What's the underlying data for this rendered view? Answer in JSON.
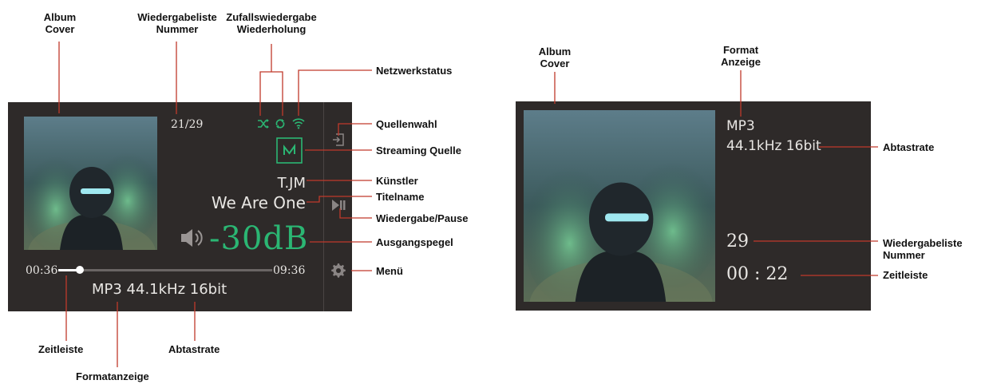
{
  "colors": {
    "screen": "#2e2a29",
    "accent": "#2bb673",
    "callout_line": "#c0392b",
    "text": "#e8e6e3"
  },
  "left_screen": {
    "playlist_number": "21/29",
    "artist": "T.JM",
    "title": "We Are One",
    "volume": "-30dB",
    "time_elapsed": "00:36",
    "time_total": "09:36",
    "progress_fraction": 0.1,
    "format_info": "MP3 44.1kHz 16bit",
    "icons": [
      "shuffle-icon",
      "repeat-icon",
      "wifi-icon",
      "input-source-icon",
      "streaming-source-icon",
      "play-pause-icon",
      "speaker-icon",
      "gear-icon"
    ]
  },
  "right_screen": {
    "format": "MP3",
    "sample_rate": "44.1kHz 16bit",
    "playlist_number": "29",
    "timeline": "00 : 22"
  },
  "callouts_left": {
    "album_cover": "Album\nCover",
    "playlist_number": "Wiedergabeliste\nNummer",
    "shuffle_repeat": "Zufallswiedergabe\nWiederholung",
    "network_status": "Netzwerkstatus",
    "source_select": "Quellenwahl",
    "streaming_source": "Streaming Quelle",
    "artist": "Künstler",
    "title_name": "Titelname",
    "play_pause": "Wiedergabe/Pause",
    "output_level": "Ausgangspegel",
    "menu": "Menü",
    "timeline": "Zeitleiste",
    "sample_rate": "Abtastrate",
    "format_display": "Formatanzeige"
  },
  "callouts_right": {
    "album_cover": "Album\nCover",
    "format_display": "Format\nAnzeige",
    "sample_rate": "Abtastrate",
    "playlist_number": "Wiedergabeliste\nNummer",
    "timeline": "Zeitleiste"
  }
}
